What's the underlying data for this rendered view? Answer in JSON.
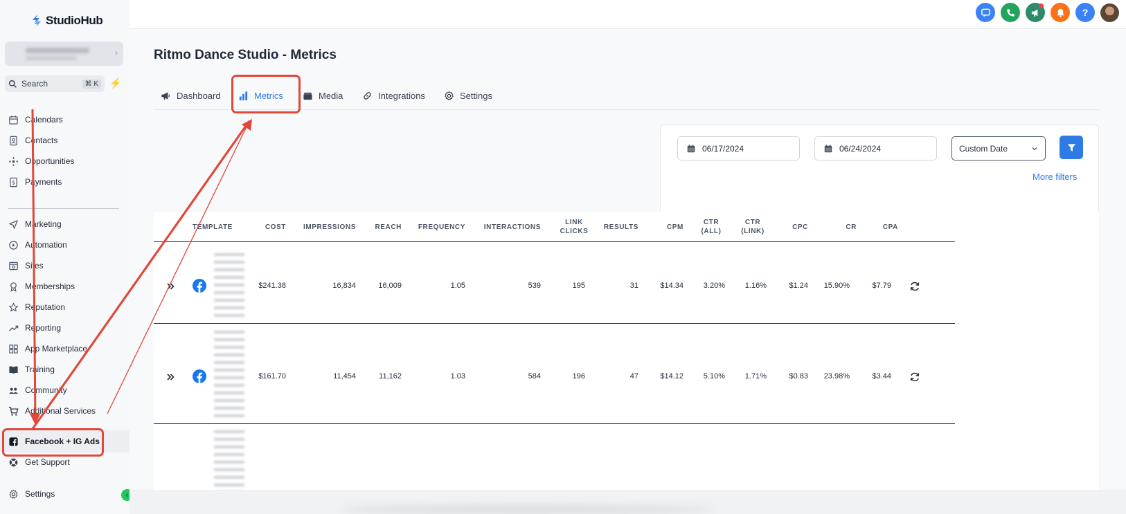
{
  "brand": {
    "name": "StudioHub"
  },
  "sidebar": {
    "search_label": "Search",
    "search_shortcut": "⌘ K",
    "items": [
      {
        "label": "Calendars",
        "icon": "calendar-icon"
      },
      {
        "label": "Contacts",
        "icon": "contacts-icon"
      },
      {
        "label": "Opportunities",
        "icon": "opportunities-icon"
      },
      {
        "label": "Payments",
        "icon": "payments-icon"
      },
      {
        "label": "Marketing",
        "icon": "send-icon"
      },
      {
        "label": "Automation",
        "icon": "automation-icon"
      },
      {
        "label": "Sites",
        "icon": "sites-icon"
      },
      {
        "label": "Memberships",
        "icon": "memberships-icon"
      },
      {
        "label": "Reputation",
        "icon": "star-icon"
      },
      {
        "label": "Reporting",
        "icon": "trend-icon"
      },
      {
        "label": "App Marketplace",
        "icon": "grid-icon"
      },
      {
        "label": "Training",
        "icon": "book-icon"
      },
      {
        "label": "Community",
        "icon": "community-icon"
      },
      {
        "label": "Additional Services",
        "icon": "cart-icon"
      },
      {
        "label": "Facebook + IG Ads",
        "icon": "facebook-square-icon"
      },
      {
        "label": "Get Support",
        "icon": "lifebuoy-icon"
      },
      {
        "label": "Settings",
        "icon": "gear-icon"
      }
    ]
  },
  "page": {
    "title": "Ritmo Dance Studio - Metrics"
  },
  "tabs": [
    {
      "label": "Dashboard",
      "icon": "megaphone-icon"
    },
    {
      "label": "Metrics",
      "icon": "bar-chart-icon"
    },
    {
      "label": "Media",
      "icon": "folder-icon"
    },
    {
      "label": "Integrations",
      "icon": "link-icon"
    },
    {
      "label": "Settings",
      "icon": "gear-icon"
    }
  ],
  "filters": {
    "start_date": "06/17/2024",
    "end_date": "06/24/2024",
    "range_select": "Custom Date",
    "more_filters": "More filters"
  },
  "table": {
    "headers": {
      "template": "TEMPLATE",
      "cost": "COST",
      "impressions": "IMPRESSIONS",
      "reach": "REACH",
      "frequency": "FREQUENCY",
      "interactions": "INTERACTIONS",
      "link_clicks_1": "LINK",
      "link_clicks_2": "CLICKS",
      "results": "RESULTS",
      "cpm": "CPM",
      "ctr_all_1": "CTR",
      "ctr_all_2": "(ALL)",
      "ctr_link_1": "CTR",
      "ctr_link_2": "(LINK)",
      "cpc": "CPC",
      "cr": "CR",
      "cpa": "CPA"
    },
    "rows": [
      {
        "cost": "$241.38",
        "impressions": "16,834",
        "reach": "16,009",
        "frequency": "1.05",
        "interactions": "539",
        "link_clicks": "195",
        "results": "31",
        "cpm": "$14.34",
        "ctr_all": "3.20%",
        "ctr_link": "1.16%",
        "cpc": "$1.24",
        "cr": "15.90%",
        "cpa": "$7.79"
      },
      {
        "cost": "$161.70",
        "impressions": "11,454",
        "reach": "11,162",
        "frequency": "1.03",
        "interactions": "584",
        "link_clicks": "196",
        "results": "47",
        "cpm": "$14.12",
        "ctr_all": "5.10%",
        "ctr_link": "1.71%",
        "cpc": "$0.83",
        "cr": "23.98%",
        "cpa": "$3.44"
      }
    ]
  },
  "colors": {
    "accent": "#2f7be5",
    "annotation": "#e0483a",
    "success": "#22c55e",
    "facebook": "#1877f2"
  }
}
